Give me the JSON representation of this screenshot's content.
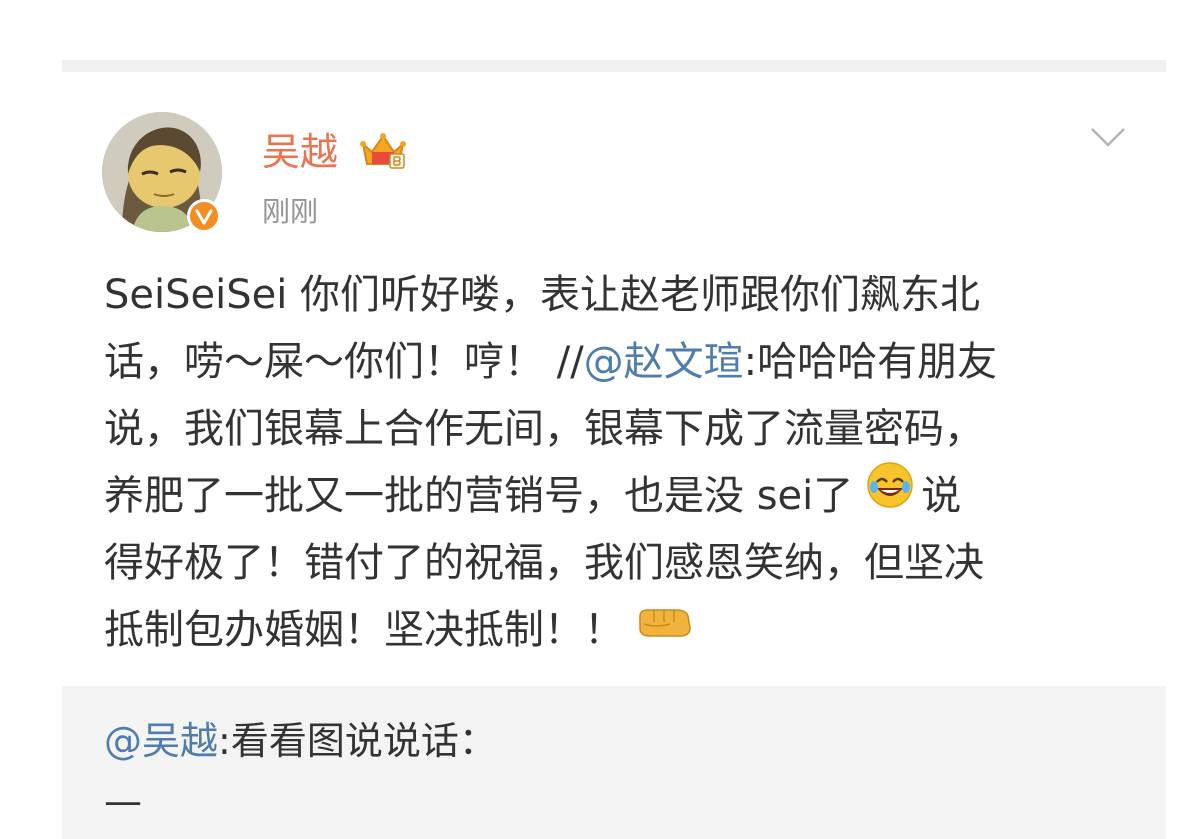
{
  "post": {
    "author": "吴越",
    "timestamp": "刚刚",
    "lines": [
      [
        {
          "t": "SeiSeiSei 你们听好喽，表让赵老师跟你们飙东北"
        }
      ],
      [
        {
          "t": "话，唠～屎～你们！哼！ //"
        },
        {
          "t": "@赵文瑄",
          "m": true
        },
        {
          "t": ":哈哈哈有朋友"
        }
      ],
      [
        {
          "t": "说，我们银幕上合作无间，银幕下成了流量密码，"
        }
      ],
      [
        {
          "t": "养肥了一批又一批的营销号，也是没 sei了"
        },
        {
          "e": "laughing-emoji"
        },
        {
          "t": "说"
        }
      ],
      [
        {
          "t": "得好极了！错付了的祝福，我们感恩笑纳，但坚决"
        }
      ],
      [
        {
          "t": "抵制包办婚姻！坚决抵制！！"
        },
        {
          "e": "fist-emoji"
        }
      ]
    ]
  },
  "repost": {
    "mention": "@吴越",
    "text": ":看看图说说话：",
    "dash": "—"
  },
  "icons": {
    "avatar": "avatar-illustration",
    "verified": "verified-badge-icon",
    "vip": "vip-crown-icon",
    "menu": "chevron-down-icon",
    "laughing": "laughing-emoji",
    "fist": "fist-emoji"
  },
  "colors": {
    "username": "#eb7350",
    "mention": "#507daf",
    "text": "#333333",
    "timestamp": "#939393",
    "verified": "#f28f24",
    "repost_bg": "#f4f4f4"
  }
}
